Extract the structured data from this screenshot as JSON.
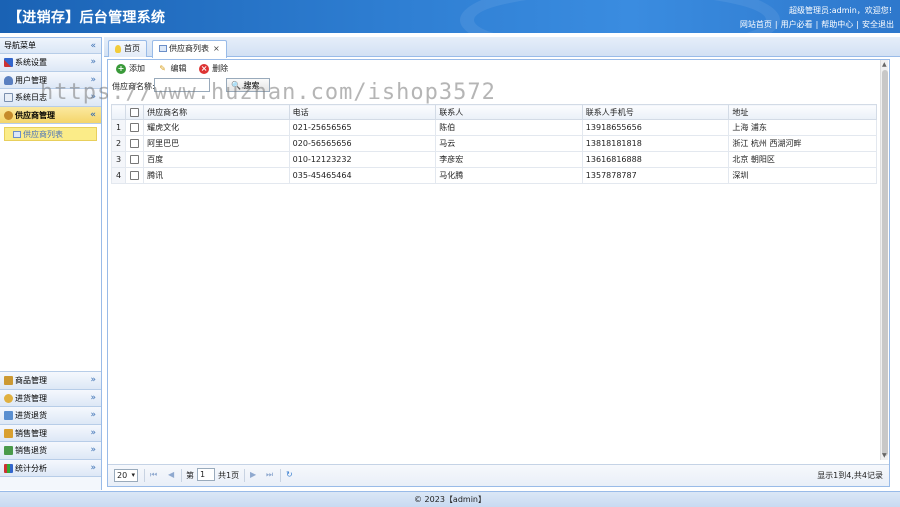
{
  "app": {
    "title": "【进销存】后台管理系统"
  },
  "header": {
    "welcome": "超级管理员:admin，欢迎您!",
    "links": [
      "网站首页",
      "用户必看",
      "帮助中心",
      "安全退出"
    ]
  },
  "sidebar": {
    "title": "导航菜单",
    "top_items": [
      {
        "label": "系统设置",
        "icon": "gear-tools-icon"
      },
      {
        "label": "用户管理",
        "icon": "user-icon"
      },
      {
        "label": "系统日志",
        "icon": "log-icon"
      },
      {
        "label": "供应商管理",
        "icon": "supplier-icon",
        "active": true
      }
    ],
    "sub_items": [
      {
        "label": "供应商列表",
        "selected": true
      }
    ],
    "bottom_items": [
      {
        "label": "商品管理"
      },
      {
        "label": "进货管理"
      },
      {
        "label": "进货退货"
      },
      {
        "label": "销售管理"
      },
      {
        "label": "销售退货"
      },
      {
        "label": "统计分析"
      }
    ]
  },
  "tabs": [
    {
      "label": "首页",
      "icon": "bulb-icon"
    },
    {
      "label": "供应商列表",
      "icon": "list-icon",
      "closable": true,
      "selected": true
    }
  ],
  "toolbar": {
    "add": "添加",
    "edit": "编辑",
    "delete": "删除"
  },
  "search": {
    "label": "供应商名称:",
    "value": "",
    "button": "搜索"
  },
  "grid": {
    "columns": [
      "供应商名称",
      "电话",
      "联系人",
      "联系人手机号",
      "地址"
    ],
    "rows": [
      {
        "num": "1",
        "name": "耀虎文化",
        "phone": "021-25656565",
        "contact": "陈伯",
        "mobile": "13918655656",
        "address": "上海 浦东"
      },
      {
        "num": "2",
        "name": "阿里巴巴",
        "phone": "020-56565656",
        "contact": "马云",
        "mobile": "13818181818",
        "address": "浙江 杭州 西湖河畔"
      },
      {
        "num": "3",
        "name": "百度",
        "phone": "010-12123232",
        "contact": "李彦宏",
        "mobile": "13616816888",
        "address": "北京 朝阳区"
      },
      {
        "num": "4",
        "name": "腾讯",
        "phone": "035-45465464",
        "contact": "马化腾",
        "mobile": "1357878787",
        "address": "深圳"
      }
    ]
  },
  "pager": {
    "page_size": "20",
    "page_prefix": "第",
    "current_page": "1",
    "total_pages": "共1页",
    "info": "显示1到4,共4记录"
  },
  "footer": {
    "text": "© 2023【admin】"
  },
  "watermark": {
    "text": "https://www.huzhan.com/ishop3572"
  },
  "colors": {
    "header": "#2a74c8",
    "active_nav": "#f4d56a",
    "border": "#99bbe8"
  }
}
